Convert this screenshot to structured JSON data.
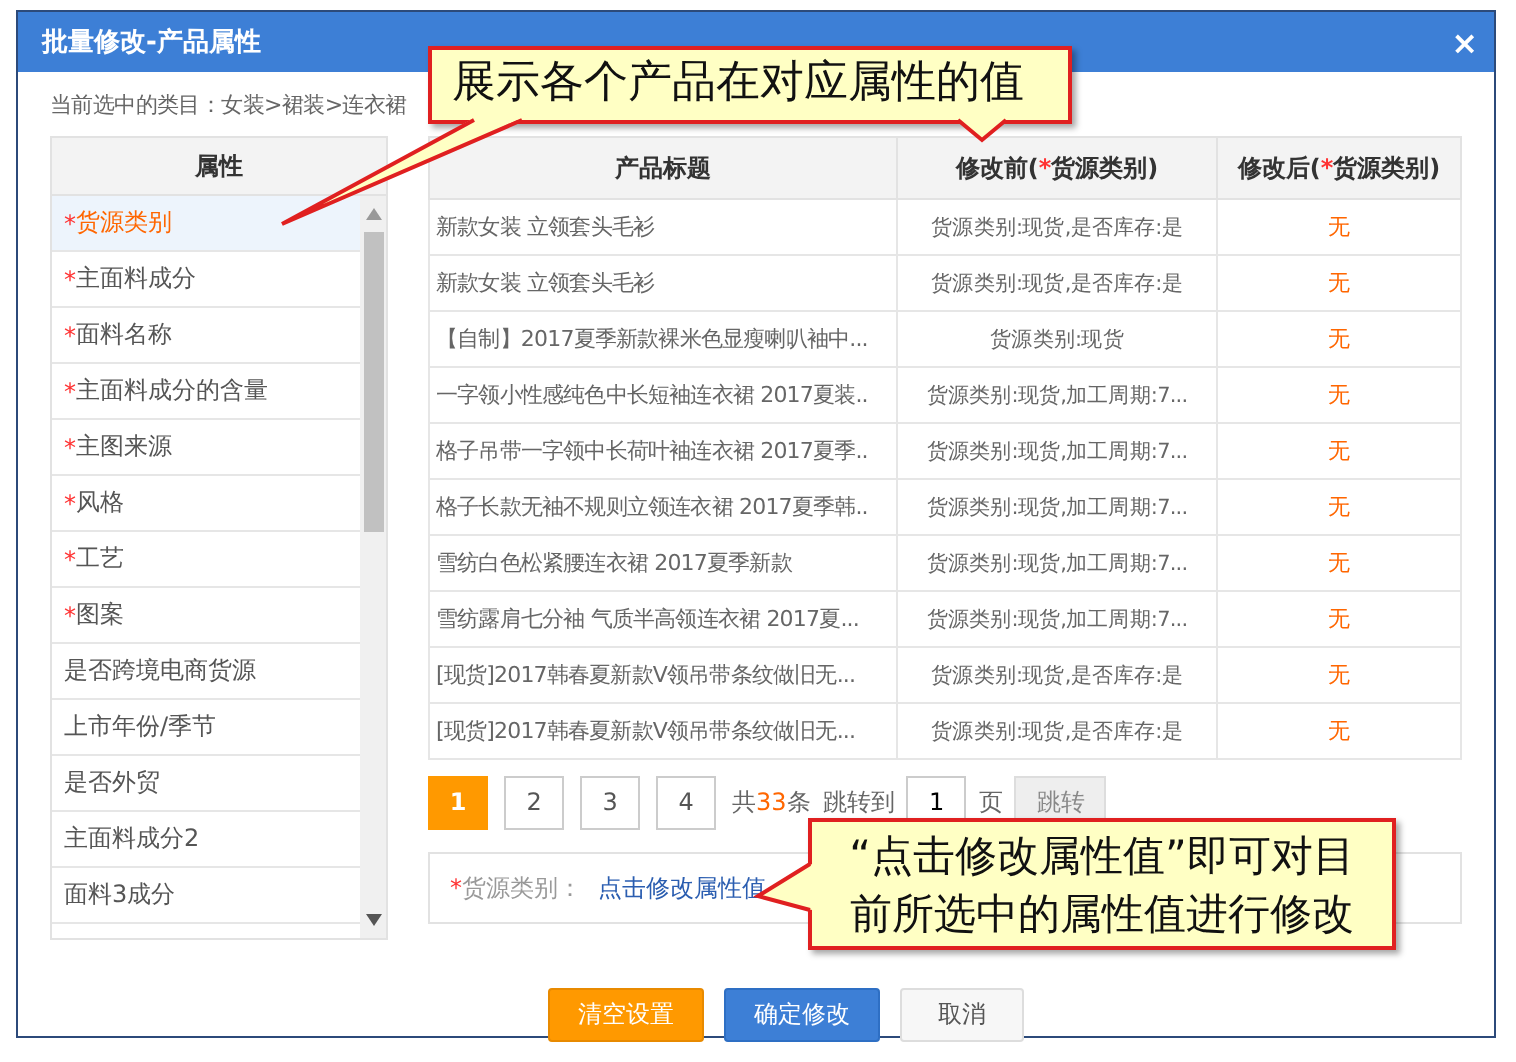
{
  "window": {
    "title": "批量修改-产品属性",
    "close": "×"
  },
  "breadcrumb": "当前选中的类目：女装>裙装>连衣裙",
  "attributes": {
    "header": "属性",
    "items": [
      {
        "mark": "*",
        "label": "货源类别",
        "selected": true
      },
      {
        "mark": "*",
        "label": "主面料成分",
        "selected": false
      },
      {
        "mark": "*",
        "label": "面料名称",
        "selected": false
      },
      {
        "mark": "*",
        "label": "主面料成分的含量",
        "selected": false
      },
      {
        "mark": "*",
        "label": "主图来源",
        "selected": false
      },
      {
        "mark": "*",
        "label": "风格",
        "selected": false
      },
      {
        "mark": "*",
        "label": "工艺",
        "selected": false
      },
      {
        "mark": "*",
        "label": "图案",
        "selected": false
      },
      {
        "label": "是否跨境电商货源",
        "selected": false
      },
      {
        "label": "上市年份/季节",
        "selected": false
      },
      {
        "label": "是否外贸",
        "selected": false
      },
      {
        "label": "主面料成分2",
        "selected": false
      },
      {
        "label": "面料3成分",
        "selected": false
      }
    ]
  },
  "table": {
    "columns": [
      {
        "label": "产品标题"
      },
      {
        "label": "修改前(",
        "mark": "*",
        "label_end": "货源类别)"
      },
      {
        "label": "修改后(",
        "mark": "*",
        "label_end": "货源类别)"
      }
    ],
    "rows": [
      {
        "title": "新款女装 立领套头毛衫",
        "before": "货源类别:现货,是否库存:是",
        "after": "无"
      },
      {
        "title": "新款女装 立领套头毛衫",
        "before": "货源类别:现货,是否库存:是",
        "after": "无"
      },
      {
        "title": "【自制】2017夏季新款裸米色显瘦喇叭袖中...",
        "before": "货源类别:现货",
        "after": "无"
      },
      {
        "title": "一字领小性感纯色中长短袖连衣裙 2017夏装..",
        "before": "货源类别:现货,加工周期:7...",
        "after": "无"
      },
      {
        "title": "格子吊带一字领中长荷叶袖连衣裙 2017夏季..",
        "before": "货源类别:现货,加工周期:7...",
        "after": "无"
      },
      {
        "title": "格子长款无袖不规则立领连衣裙 2017夏季韩..",
        "before": "货源类别:现货,加工周期:7...",
        "after": "无"
      },
      {
        "title": "雪纺白色松紧腰连衣裙 2017夏季新款",
        "before": "货源类别:现货,加工周期:7...",
        "after": "无"
      },
      {
        "title": "雪纺露肩七分袖 气质半高领连衣裙 2017夏...",
        "before": "货源类别:现货,加工周期:7...",
        "after": "无"
      },
      {
        "title": "[现货]2017韩春夏新款V领吊带条纹做旧无...",
        "before": "货源类别:现货,是否库存:是",
        "after": "无"
      },
      {
        "title": "[现货]2017韩春夏新款V领吊带条纹做旧无...",
        "before": "货源类别:现货,是否库存:是",
        "after": "无"
      }
    ]
  },
  "pagination": {
    "pages": [
      {
        "label": "1",
        "selected": true
      },
      {
        "label": "2",
        "selected": false
      },
      {
        "label": "3",
        "selected": false
      },
      {
        "label": "4",
        "selected": false
      }
    ],
    "total_prefix": "共",
    "total": "33",
    "total_suffix": "条",
    "jump_label": "跳转到",
    "jump_value": "1",
    "page_unit": "页",
    "jump_button": "跳转"
  },
  "field": {
    "mark": "*",
    "label": "货源类别：",
    "link": "点击修改属性值"
  },
  "buttons": [
    {
      "label": "清空设置",
      "kind": "warning"
    },
    {
      "label": "确定修改",
      "kind": "primary"
    },
    {
      "label": "取消",
      "kind": "default"
    }
  ],
  "callouts": [
    {
      "text": "展示各个产品在对应属性的值"
    },
    {
      "text": "“点击修改属性值”即可对目前所选中的属性值进行修改"
    }
  ]
}
